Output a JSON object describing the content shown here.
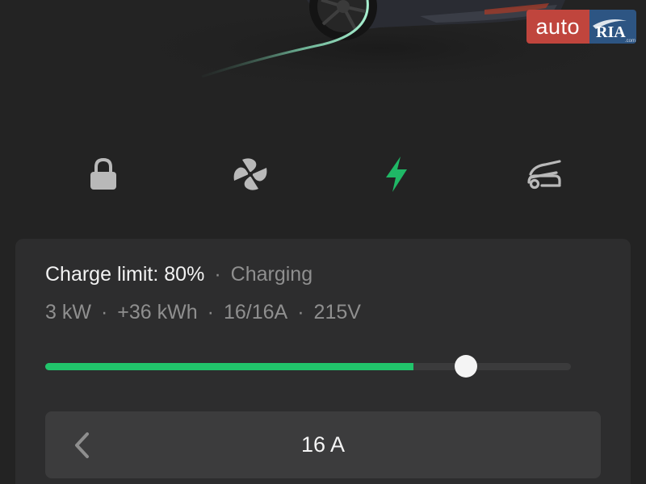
{
  "watermark": {
    "brand_left": "auto",
    "brand_right": "RIA",
    "brand_right_small": ".com",
    "colors": {
      "left": "#c0453d",
      "right": "#2d5583"
    }
  },
  "quick_controls": [
    {
      "name": "lock",
      "icon": "lock-icon",
      "active": false
    },
    {
      "name": "climate",
      "icon": "fan-icon",
      "active": false
    },
    {
      "name": "charging",
      "icon": "lightning-bolt-icon",
      "active": true
    },
    {
      "name": "frunk",
      "icon": "car-frunk-open-icon",
      "active": false
    }
  ],
  "charge": {
    "limit_label": "Charge limit: 80%",
    "separator": "·",
    "status": "Charging",
    "stats": [
      "3 kW",
      "+36 kWh",
      "16/16A",
      "215V"
    ],
    "level_percent": 70,
    "limit_percent": 80
  },
  "amperage": {
    "value": "16 A"
  },
  "colors": {
    "background": "#232323",
    "card": "#2d2d2e",
    "accent_green": "#21c46b",
    "icon_gray": "#b9b9b9"
  }
}
